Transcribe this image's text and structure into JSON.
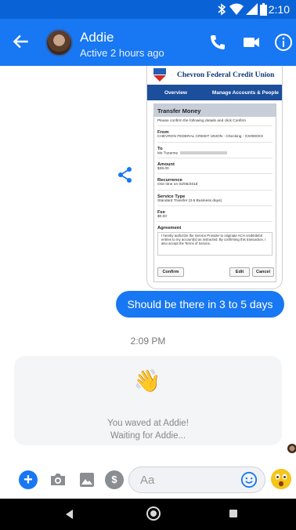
{
  "status_bar": {
    "time": "2:10"
  },
  "header": {
    "contact_name": "Addie",
    "contact_status": "Active 2 hours ago"
  },
  "shared_image": {
    "bank_name": "Chevron Federal Credit Union",
    "nav": [
      "Overview",
      "Manage Accounts & People"
    ],
    "title": "Transfer Money",
    "intro": "Please confirm the following details and click Confirm",
    "fields": [
      {
        "label": "From",
        "value": "CHEVRON FEDERAL CREDIT UNION - Checking - XX0000XX"
      },
      {
        "label": "To",
        "value": "Ms Tuzanne"
      },
      {
        "label": "Amount",
        "value": "$39.00"
      },
      {
        "label": "Recurrence",
        "value": "One time on 02/06/2018"
      },
      {
        "label": "Service Type",
        "value": "Standard Transfer (3-5 Business days)"
      },
      {
        "label": "Fee",
        "value": "$0.00"
      }
    ],
    "agreement_label": "Agreement",
    "agreement_text": "I hereby authorize the Service Provider to originate ACH credit/debit entries to my account(s) as instructed. By confirming this transaction, I also accept the Terms of Service.",
    "buttons": {
      "confirm": "Confirm",
      "edit": "Edit",
      "cancel": "Cancel"
    }
  },
  "messages": {
    "sent_text": "Should be there in 3 to 5 days",
    "timestamp": "2:09 PM",
    "wave_emoji": "👋",
    "wave_line1": "You waved at Addie!",
    "wave_line2": "Waiting for Addie..."
  },
  "composer": {
    "placeholder": "Aa"
  },
  "icons": {
    "back": "arrow-left-icon",
    "call": "phone-icon",
    "video": "video-camera-icon",
    "info": "info-icon",
    "share": "share-icon",
    "camera": "camera-icon",
    "gallery": "image-icon",
    "payment": "dollar-icon",
    "emoji": "smiley-icon"
  },
  "colors": {
    "brand": "#1877f2",
    "status_bar": "#0a63d6"
  }
}
